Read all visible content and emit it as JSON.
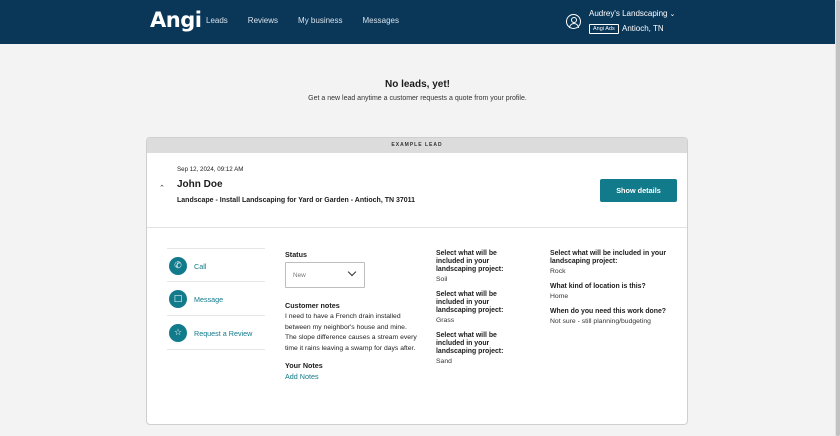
{
  "header": {
    "logo": "Angi",
    "nav": [
      "Leads",
      "Reviews",
      "My business",
      "Messages"
    ],
    "account": {
      "business": "Audrey's Landscaping",
      "badge": "Angi Ads",
      "location": "Antioch, TN"
    }
  },
  "empty_state": {
    "title": "No leads, yet!",
    "subtitle": "Get a new lead anytime a customer requests a quote from your profile."
  },
  "example_lead": {
    "banner": "EXAMPLE LEAD",
    "date": "Sep 12, 2024, 09:12 AM",
    "name": "John Doe",
    "service": "Landscape - Install Landscaping for Yard or Garden - Antioch, TN 37011",
    "show_details": "Show details",
    "actions": [
      {
        "label": "Call",
        "icon": "phone-icon"
      },
      {
        "label": "Message",
        "icon": "chat-icon"
      },
      {
        "label": "Request a Review",
        "icon": "star-icon"
      }
    ],
    "status": {
      "label": "Status",
      "value": "New"
    },
    "customer_notes": {
      "label": "Customer notes",
      "text": "I need to have a French drain installed between my neighbor's house and mine. The slope difference causes a stream every time it rains leaving a swamp for days after."
    },
    "your_notes": {
      "label": "Your Notes",
      "link": "Add Notes"
    },
    "qa_left": [
      {
        "q": "Select what will be included in your landscaping project:",
        "a": "Soil"
      },
      {
        "q": "Select what will be included in your landscaping project:",
        "a": "Grass"
      },
      {
        "q": "Select what will be included in your landscaping project:",
        "a": "Sand"
      }
    ],
    "qa_right": [
      {
        "q": "Select what will be included in your landscaping project:",
        "a": "Rock"
      },
      {
        "q": "What kind of location is this?",
        "a": "Home"
      },
      {
        "q": "When do you need this work done?",
        "a": "Not sure - still planning/budgeting"
      }
    ]
  },
  "colors": {
    "header_bg": "#0a3658",
    "accent": "#117a8b"
  }
}
